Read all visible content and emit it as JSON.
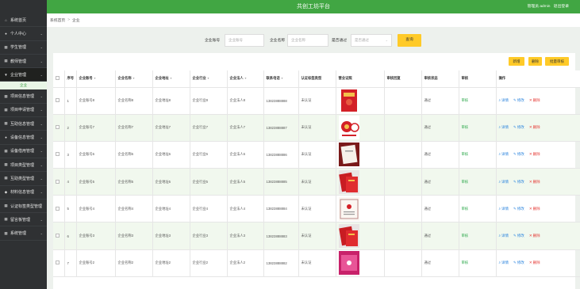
{
  "header": {
    "title": "共创工坊平台",
    "user_label": "管理员 admin",
    "logout": "退出登录"
  },
  "sidebar": {
    "items": [
      {
        "icon": "home-icon",
        "glyph": "⌂",
        "label": "系统首页",
        "chevron": false
      },
      {
        "icon": "user-icon",
        "glyph": "●",
        "label": "个人中心",
        "chevron": true
      },
      {
        "icon": "grid-icon",
        "glyph": "▦",
        "label": "学生管理",
        "chevron": true
      },
      {
        "icon": "grid-icon",
        "glyph": "▦",
        "label": "教师管理",
        "chevron": true
      },
      {
        "icon": "funnel-icon",
        "glyph": "▼",
        "label": "企业管理",
        "chevron": true,
        "active": true
      },
      {
        "icon": "grid-icon",
        "glyph": "▦",
        "label": "项目信息管理",
        "chevron": true
      },
      {
        "icon": "grid-icon",
        "glyph": "▦",
        "label": "项目申请管理",
        "chevron": true
      },
      {
        "icon": "grid-icon",
        "glyph": "▦",
        "label": "互助信息管理",
        "chevron": true
      },
      {
        "icon": "user-icon",
        "glyph": "●",
        "label": "设备信息管理",
        "chevron": true
      },
      {
        "icon": "grid-icon",
        "glyph": "▦",
        "label": "设备借用管理",
        "chevron": true
      },
      {
        "icon": "grid-icon",
        "glyph": "▦",
        "label": "项目类型管理",
        "chevron": true
      },
      {
        "icon": "grid-icon",
        "glyph": "▦",
        "label": "互助类型管理",
        "chevron": true
      },
      {
        "icon": "location-icon",
        "glyph": "◆",
        "label": "材料信息管理",
        "chevron": true
      },
      {
        "icon": "grid-icon",
        "glyph": "▦",
        "label": "认证标签类型管理",
        "chevron": false
      },
      {
        "icon": "grid-icon",
        "glyph": "▦",
        "label": "留言板管理",
        "chevron": true
      },
      {
        "icon": "grid-icon",
        "glyph": "▦",
        "label": "系统管理",
        "chevron": true
      }
    ],
    "active_sub": "企业"
  },
  "breadcrumb": {
    "home": "系统首页",
    "separator": ">",
    "current": "企业"
  },
  "search": {
    "account_label": "企业账号",
    "account_placeholder": "企业账号",
    "name_label": "企业名称",
    "name_placeholder": "企业名称",
    "approved_label": "是否通过",
    "approved_placeholder": "是否通过",
    "query_button": "查询"
  },
  "actions": {
    "add": "新增",
    "delete": "删除",
    "batch_review": "批量审核"
  },
  "table": {
    "columns": [
      "",
      "序号",
      "企业账号",
      "企业名称",
      "企业地址",
      "企业行业",
      "企业法人",
      "联系电话",
      "认证标签类型",
      "营业证照",
      "审核回复",
      "审核状态",
      "审核",
      "操作"
    ],
    "rows": [
      {
        "no": "1",
        "account": "企业账号8",
        "name": "企业名称8",
        "address": "企业地址8",
        "industry": "企业行业8",
        "legal": "企业法人8",
        "phone": "13823888888",
        "tag": "未认证",
        "photo": "red-certificate-book",
        "reply": "",
        "status": "通过",
        "review": "审核"
      },
      {
        "no": "2",
        "account": "企业账号7",
        "name": "企业名称7",
        "address": "企业地址7",
        "industry": "企业行业7",
        "legal": "企业法人7",
        "phone": "13823888887",
        "tag": "未认证",
        "photo": "trademark-seal",
        "reply": "",
        "status": "通过",
        "review": "审核"
      },
      {
        "no": "3",
        "account": "企业账号6",
        "name": "企业名称6",
        "address": "企业地址6",
        "industry": "企业行业6",
        "legal": "企业法人6",
        "phone": "13823888886",
        "tag": "未认证",
        "photo": "open-certificate",
        "reply": "",
        "status": "通过",
        "review": "审核"
      },
      {
        "no": "4",
        "account": "企业账号5",
        "name": "企业名称5",
        "address": "企业地址5",
        "industry": "企业行业5",
        "legal": "企业法人5",
        "phone": "13823888885",
        "tag": "未认证",
        "photo": "red-booklets",
        "reply": "",
        "status": "通过",
        "review": "审核"
      },
      {
        "no": "5",
        "account": "企业账号4",
        "name": "企业名称4",
        "address": "企业地址4",
        "industry": "企业行业4",
        "legal": "企业法人4",
        "phone": "13823888884",
        "tag": "未认证",
        "photo": "framed-certificate",
        "reply": "",
        "status": "通过",
        "review": "审核"
      },
      {
        "no": "6",
        "account": "企业账号3",
        "name": "企业名称3",
        "address": "企业地址3",
        "industry": "企业行业3",
        "legal": "企业法人3",
        "phone": "13823888883",
        "tag": "未认证",
        "photo": "red-booklets",
        "reply": "",
        "status": "通过",
        "review": "审核"
      },
      {
        "no": "7",
        "account": "企业账号2",
        "name": "企业名称2",
        "address": "企业地址2",
        "industry": "企业行业2",
        "legal": "企业法人2",
        "phone": "13823888882",
        "tag": "未认证",
        "photo": "pink-certificate",
        "reply": "",
        "status": "通过",
        "review": "审核"
      }
    ],
    "ops": {
      "view": "详情",
      "edit": "修改",
      "delete": "删除"
    }
  },
  "colors": {
    "brand": "#41a643",
    "sidebar": "#2f3133",
    "accent": "#ffca28",
    "row_alt": "#f1f8ee",
    "danger": "#e53935",
    "link": "#2e86de"
  }
}
